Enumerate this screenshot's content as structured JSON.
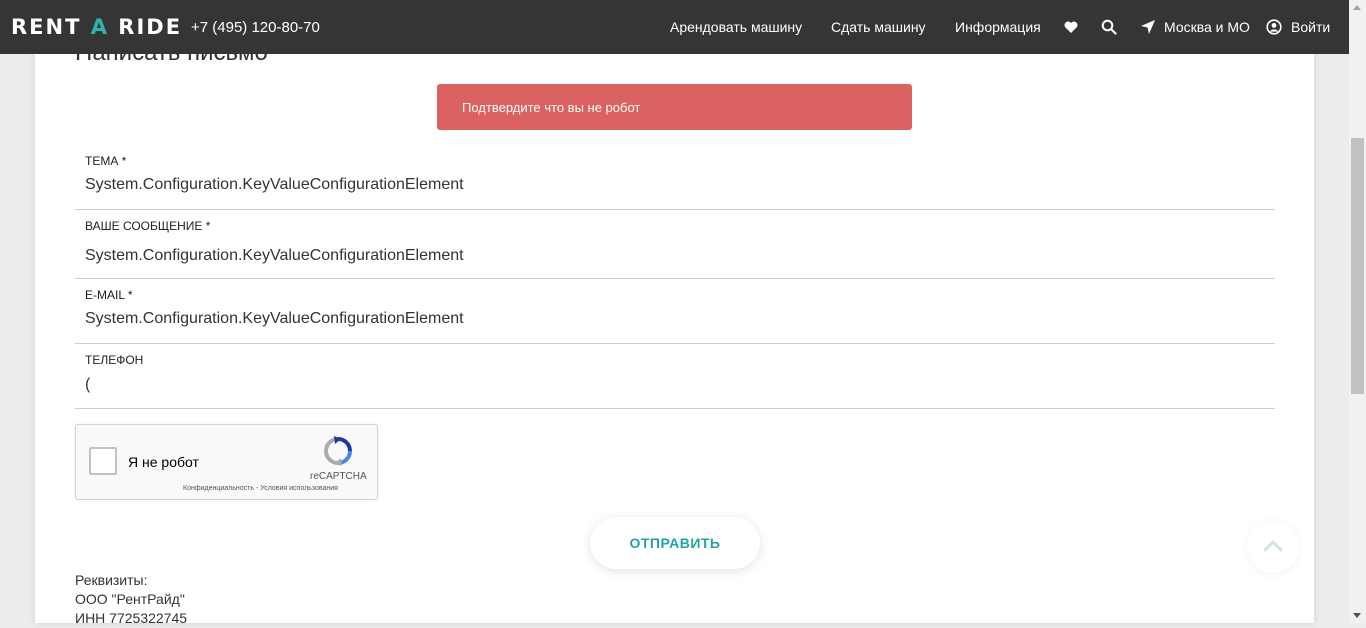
{
  "header": {
    "logo": {
      "part1": "RENT ",
      "accent": "A",
      "part2": " RIDE"
    },
    "phone": "+7 (495) 120-80-70",
    "nav": {
      "rent": "Арендовать машину",
      "lease": "Сдать машину",
      "info": "Информация",
      "location": "Москва и МО",
      "login": "Войти"
    }
  },
  "page": {
    "title": "Написать письмо",
    "alert": "Подтвердите что вы не робот"
  },
  "form": {
    "subject": {
      "label": "ТЕМА *",
      "value": "System.Configuration.KeyValueConfigurationElement"
    },
    "message": {
      "label": "ВАШЕ СООБЩЕНИЕ *",
      "value": "System.Configuration.KeyValueConfigurationElement"
    },
    "email": {
      "label": "E-MAIL *",
      "value": "System.Configuration.KeyValueConfigurationElement"
    },
    "phone": {
      "label": "ТЕЛЕФОН",
      "value": "("
    },
    "captcha": {
      "label": "Я не робот",
      "brand": "reCAPTCHA",
      "links": "Конфиденциальность - Условия использования"
    },
    "submit_label": "ОТПРАВИТЬ"
  },
  "details": {
    "heading": "Реквизиты:",
    "company": "ООО \"РентРайд\"",
    "inn": "ИНН 7725322745"
  },
  "colors": {
    "header_bg": "#353535",
    "accent": "#2bb5b0",
    "alert_bg": "#dc6262",
    "submit_text": "#1fa59f"
  },
  "icons": [
    "heart-icon",
    "search-icon",
    "location-arrow-icon",
    "user-icon",
    "recaptcha-logo-icon",
    "chevron-up-icon"
  ]
}
